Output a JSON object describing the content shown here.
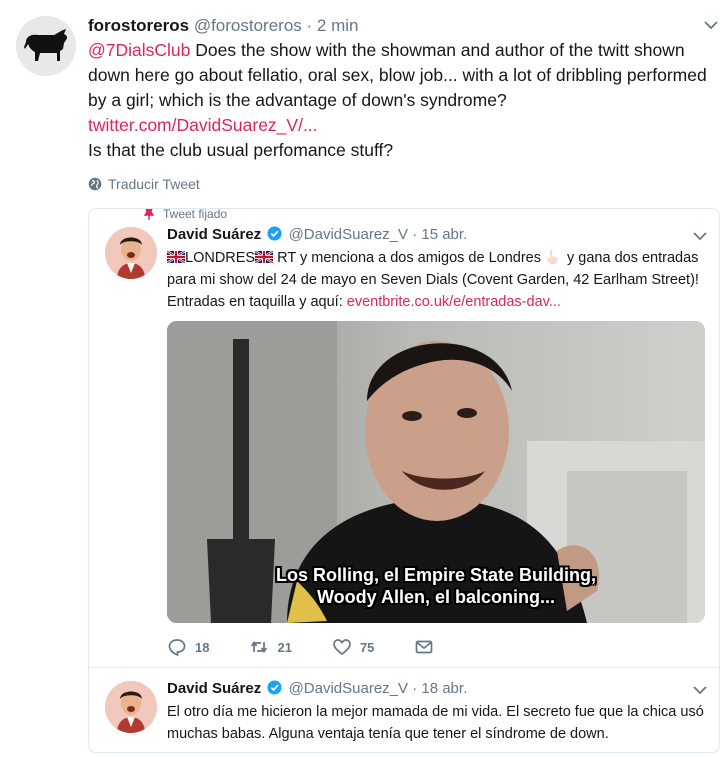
{
  "tweet": {
    "display_name": "forostoreros",
    "handle": "@forostoreros",
    "separator": "·",
    "time": "2 min",
    "mention": "@7DialsClub",
    "text_main": " Does the show with the showman and author of the twitt shown down here go about fellatio, oral sex, blow job... with a lot of dribbling performed by a girl; which is the advantage of down's syndrome?",
    "link": "twitter.com/DavidSuarez_V/...",
    "text_end": "Is that the club usual perfomance stuff?",
    "translate_label": "Traducir Tweet"
  },
  "quoted": {
    "pinned_label": "Tweet fijado",
    "display_name": "David Suárez",
    "handle": "@DavidSuarez_V",
    "separator": "·",
    "time": "15 abr.",
    "text_part1": "LONDRES",
    "text_part2": " RT y menciona a dos amigos de Londres",
    "text_part3": " y gana dos entradas para mi show del 24 de mayo en Seven Dials (Covent Garden, 42 Earlham Street)! Entradas en taquilla y aquí: ",
    "link": "eventbrite.co.uk/e/entradas-dav...",
    "video_subtitle_line1": "Los Rolling, el Empire State Building,",
    "video_subtitle_line2": "Woody Allen, el balconing...",
    "reply_count": "18",
    "retweet_count": "21",
    "like_count": "75"
  },
  "thread_reply": {
    "display_name": "David Suárez",
    "handle": "@DavidSuarez_V",
    "separator": "·",
    "time": "18 abr.",
    "text": "El otro día me hicieron la mejor mamada de mi vida. El secreto fue que la chica usó muchas babas. Alguna ventaja tenía que tener el síndrome de down."
  },
  "colors": {
    "link_accent": "#e0245e",
    "muted": "#657786",
    "verified": "#1da1f2"
  }
}
